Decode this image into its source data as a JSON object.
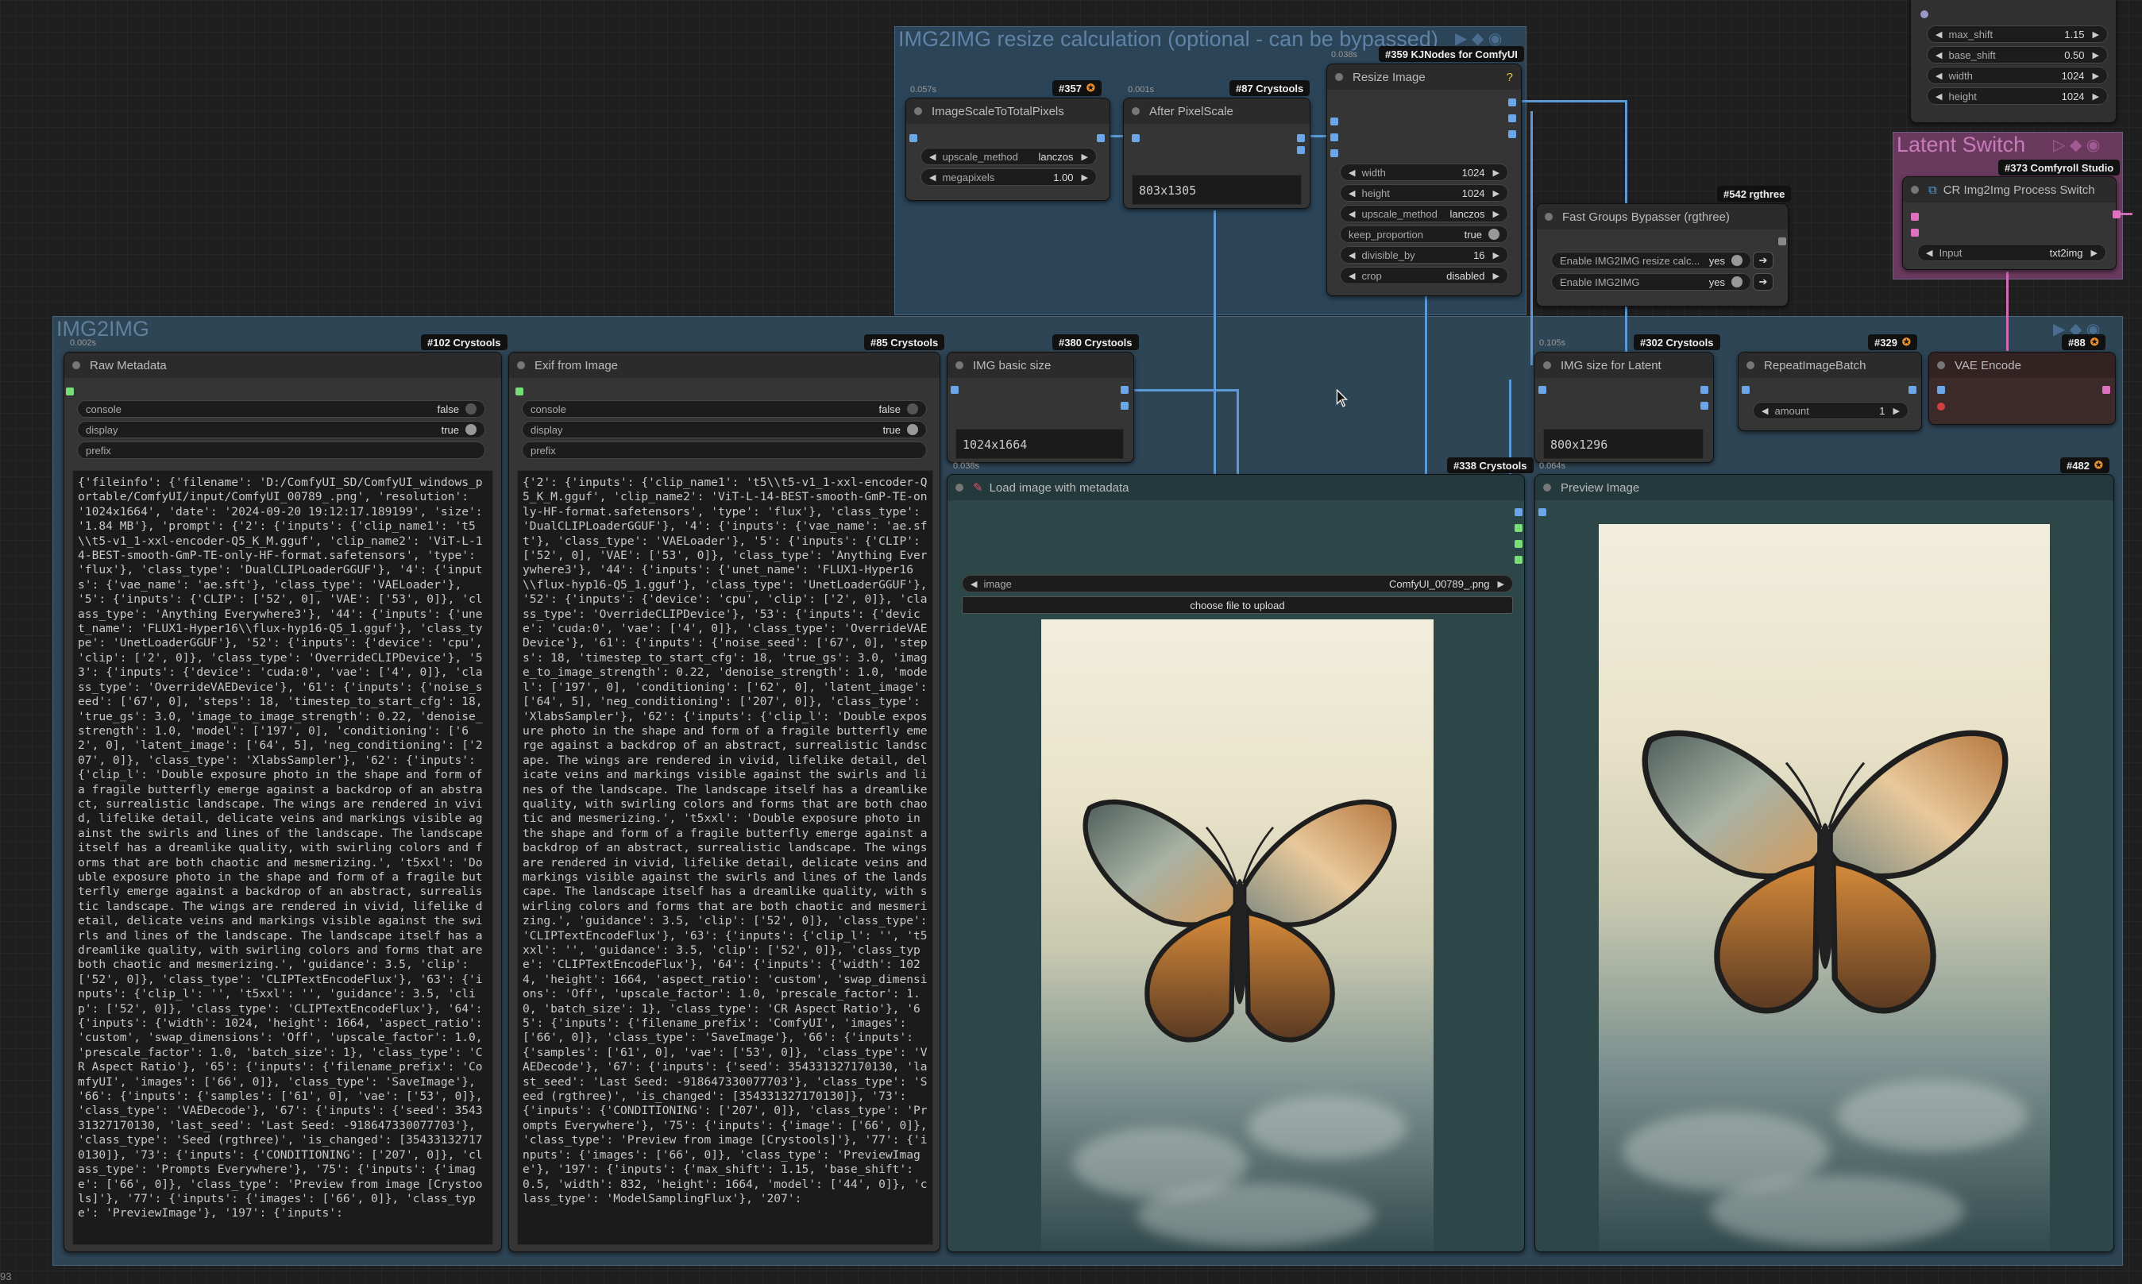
{
  "groups": {
    "resize_group_title": "IMG2IMG resize calculation (optional - can be bypassed)",
    "img2img_group_title": "IMG2IMG",
    "latent_switch_title": "Latent Switch"
  },
  "badges": {
    "n357": "#357",
    "n87": "#87 Crystools",
    "n359": "#359 KJNodes for ComfyUI",
    "n542": "#542 rgthree",
    "n373": "#373 Comfyroll Studio",
    "n102": "#102 Crystools",
    "n85": "#85 Crystools",
    "n380": "#380 Crystools",
    "n302": "#302 Crystools",
    "n329": "#329",
    "n88": "#88",
    "n338": "#338 Crystools",
    "n482": "#482"
  },
  "timings": {
    "t357": "0.057s",
    "t87": "0.001s",
    "t359": "0.038s",
    "t102": "0.002s",
    "t302": "0.105s",
    "t338": "0.038s",
    "t482": "0.064s"
  },
  "nodes": {
    "image_scale": {
      "title": "ImageScaleToTotalPixels",
      "upscale_method_label": "upscale_method",
      "upscale_method_value": "lanczos",
      "megapixels_label": "megapixels",
      "megapixels_value": "1.00"
    },
    "after_pixel_scale": {
      "title": "After PixelScale",
      "value": "803x1305"
    },
    "resize_image": {
      "title": "Resize Image",
      "width_label": "width",
      "width_value": "1024",
      "height_label": "height",
      "height_value": "1024",
      "upscale_method_label": "upscale_method",
      "upscale_method_value": "lanczos",
      "keep_proportion_label": "keep_proportion",
      "keep_proportion_value": "true",
      "divisible_by_label": "divisible_by",
      "divisible_by_value": "16",
      "crop_label": "crop",
      "crop_value": "disabled"
    },
    "model_sampling": {
      "max_shift_label": "max_shift",
      "max_shift_value": "1.15",
      "base_shift_label": "base_shift",
      "base_shift_value": "0.50",
      "width_label": "width",
      "width_value": "1024",
      "height_label": "height",
      "height_value": "1024"
    },
    "fast_groups_bypasser": {
      "title": "Fast Groups Bypasser (rgthree)",
      "item1_label": "Enable IMG2IMG resize calc...",
      "item1_value": "yes",
      "item2_label": "Enable IMG2IMG",
      "item2_value": "yes"
    },
    "cr_switch": {
      "title": "CR Img2Img Process Switch",
      "input_label": "Input",
      "input_value": "txt2img"
    },
    "raw_metadata": {
      "title": "Raw Metadata",
      "console_label": "console",
      "console_value": "false",
      "display_label": "display",
      "display_value": "true",
      "prefix_label": "prefix",
      "text": "{'fileinfo': {'filename': 'D:/ComfyUI_SD/ComfyUI_windows_portable/ComfyUI/input/ComfyUI_00789_.png', 'resolution': '1024x1664', 'date': '2024-09-20 19:12:17.189199', 'size': '1.84 MB'}, 'prompt': {'2': {'inputs': {'clip_name1': 't5\\\\t5-v1_1-xxl-encoder-Q5_K_M.gguf', 'clip_name2': 'ViT-L-14-BEST-smooth-GmP-TE-only-HF-format.safetensors', 'type': 'flux'}, 'class_type': 'DualCLIPLoaderGGUF'}, '4': {'inputs': {'vae_name': 'ae.sft'}, 'class_type': 'VAELoader'}, '5': {'inputs': {'CLIP': ['52', 0], 'VAE': ['53', 0]}, 'class_type': 'Anything Everywhere3'}, '44': {'inputs': {'unet_name': 'FLUX1-Hyper16\\\\flux-hyp16-Q5_1.gguf'}, 'class_type': 'UnetLoaderGGUF'}, '52': {'inputs': {'device': 'cpu', 'clip': ['2', 0]}, 'class_type': 'OverrideCLIPDevice'}, '53': {'inputs': {'device': 'cuda:0', 'vae': ['4', 0]}, 'class_type': 'OverrideVAEDevice'}, '61': {'inputs': {'noise_seed': ['67', 0], 'steps': 18, 'timestep_to_start_cfg': 18, 'true_gs': 3.0, 'image_to_image_strength': 0.22, 'denoise_strength': 1.0, 'model': ['197', 0], 'conditioning': ['62', 0], 'latent_image': ['64', 5], 'neg_conditioning': ['207', 0]}, 'class_type': 'XlabsSampler'}, '62': {'inputs': {'clip_l': 'Double exposure photo in the shape and form of a fragile butterfly emerge against a backdrop of an abstract, surrealistic landscape. The wings are rendered in vivid, lifelike detail, delicate veins and markings visible against the swirls and lines of the landscape. The landscape itself has a dreamlike quality, with swirling colors and forms that are both chaotic and mesmerizing.', 't5xxl': 'Double exposure photo in the shape and form of a fragile butterfly emerge against a backdrop of an abstract, surrealistic landscape. The wings are rendered in vivid, lifelike detail, delicate veins and markings visible against the swirls and lines of the landscape. The landscape itself has a dreamlike quality, with swirling colors and forms that are both chaotic and mesmerizing.', 'guidance': 3.5, 'clip': ['52', 0]}, 'class_type': 'CLIPTextEncodeFlux'}, '63': {'inputs': {'clip_l': '', 't5xxl': '', 'guidance': 3.5, 'clip': ['52', 0]}, 'class_type': 'CLIPTextEncodeFlux'}, '64': {'inputs': {'width': 1024, 'height': 1664, 'aspect_ratio': 'custom', 'swap_dimensions': 'Off', 'upscale_factor': 1.0, 'prescale_factor': 1.0, 'batch_size': 1}, 'class_type': 'CR Aspect Ratio'}, '65': {'inputs': {'filename_prefix': 'ComfyUI', 'images': ['66', 0]}, 'class_type': 'SaveImage'}, '66': {'inputs': {'samples': ['61', 0], 'vae': ['53', 0]}, 'class_type': 'VAEDecode'}, '67': {'inputs': {'seed': 354331327170130, 'last_seed': 'Last Seed: -918647330077703'}, 'class_type': 'Seed (rgthree)', 'is_changed': [354331327170130]}, '73': {'inputs': {'CONDITIONING': ['207', 0]}, 'class_type': 'Prompts Everywhere'}, '75': {'inputs': {'image': ['66', 0]}, 'class_type': 'Preview from image [Crystools]'}, '77': {'inputs': {'images': ['66', 0]}, 'class_type': 'PreviewImage'}, '197': {'inputs':"
    },
    "exif": {
      "title": "Exif from Image",
      "console_label": "console",
      "console_value": "false",
      "display_label": "display",
      "display_value": "true",
      "prefix_label": "prefix",
      "text": "{'2': {'inputs': {'clip_name1': 't5\\\\t5-v1_1-xxl-encoder-Q5_K_M.gguf', 'clip_name2': 'ViT-L-14-BEST-smooth-GmP-TE-only-HF-format.safetensors', 'type': 'flux'}, 'class_type': 'DualCLIPLoaderGGUF'}, '4': {'inputs': {'vae_name': 'ae.sft'}, 'class_type': 'VAELoader'}, '5': {'inputs': {'CLIP': ['52', 0], 'VAE': ['53', 0]}, 'class_type': 'Anything Everywhere3'}, '44': {'inputs': {'unet_name': 'FLUX1-Hyper16\\\\flux-hyp16-Q5_1.gguf'}, 'class_type': 'UnetLoaderGGUF'}, '52': {'inputs': {'device': 'cpu', 'clip': ['2', 0]}, 'class_type': 'OverrideCLIPDevice'}, '53': {'inputs': {'device': 'cuda:0', 'vae': ['4', 0]}, 'class_type': 'OverrideVAEDevice'}, '61': {'inputs': {'noise_seed': ['67', 0], 'steps': 18, 'timestep_to_start_cfg': 18, 'true_gs': 3.0, 'image_to_image_strength': 0.22, 'denoise_strength': 1.0, 'model': ['197', 0], 'conditioning': ['62', 0], 'latent_image': ['64', 5], 'neg_conditioning': ['207', 0]}, 'class_type': 'XlabsSampler'}, '62': {'inputs': {'clip_l': 'Double exposure photo in the shape and form of a fragile butterfly emerge against a backdrop of an abstract, surrealistic landscape. The wings are rendered in vivid, lifelike detail, delicate veins and markings visible against the swirls and lines of the landscape. The landscape itself has a dreamlike quality, with swirling colors and forms that are both chaotic and mesmerizing.', 't5xxl': 'Double exposure photo in the shape and form of a fragile butterfly emerge against a backdrop of an abstract, surrealistic landscape. The wings are rendered in vivid, lifelike detail, delicate veins and markings visible against the swirls and lines of the landscape. The landscape itself has a dreamlike quality, with swirling colors and forms that are both chaotic and mesmerizing.', 'guidance': 3.5, 'clip': ['52', 0]}, 'class_type': 'CLIPTextEncodeFlux'}, '63': {'inputs': {'clip_l': '', 't5xxl': '', 'guidance': 3.5, 'clip': ['52', 0]}, 'class_type': 'CLIPTextEncodeFlux'}, '64': {'inputs': {'width': 1024, 'height': 1664, 'aspect_ratio': 'custom', 'swap_dimensions': 'Off', 'upscale_factor': 1.0, 'prescale_factor': 1.0, 'batch_size': 1}, 'class_type': 'CR Aspect Ratio'}, '65': {'inputs': {'filename_prefix': 'ComfyUI', 'images': ['66', 0]}, 'class_type': 'SaveImage'}, '66': {'inputs': {'samples': ['61', 0], 'vae': ['53', 0]}, 'class_type': 'VAEDecode'}, '67': {'inputs': {'seed': 354331327170130, 'last_seed': 'Last Seed: -918647330077703'}, 'class_type': 'Seed (rgthree)', 'is_changed': [354331327170130]}, '73': {'inputs': {'CONDITIONING': ['207', 0]}, 'class_type': 'Prompts Everywhere'}, '75': {'inputs': {'image': ['66', 0]}, 'class_type': 'Preview from image [Crystools]'}, '77': {'inputs': {'images': ['66', 0]}, 'class_type': 'PreviewImage'}, '197': {'inputs': {'max_shift': 1.15, 'base_shift': 0.5, 'width': 832, 'height': 1664, 'model': ['44', 0]}, 'class_type': 'ModelSamplingFlux'}, '207':"
    },
    "img_basic_size": {
      "title": "IMG basic size",
      "value": "1024x1664"
    },
    "img_size_latent": {
      "title": "IMG size for Latent",
      "value": "800x1296"
    },
    "repeat_batch": {
      "title": "RepeatImageBatch",
      "amount_label": "amount",
      "amount_value": "1"
    },
    "vae_encode": {
      "title": "VAE Encode"
    },
    "load_image": {
      "title": "Load image with metadata",
      "image_label": "image",
      "image_value": "ComfyUI_00789_.png",
      "upload_label": "choose file to upload"
    },
    "preview_image": {
      "title": "Preview Image"
    }
  },
  "footer": {
    "corner_text": "93"
  },
  "colors": {
    "wire_image": "#5b9ad6",
    "wire_latent": "#d06cb6",
    "resize_group_bg": "#2b4458",
    "img2img_group_bg": "#2e4556",
    "latent_switch_group_bg": "#6a3a5e"
  }
}
